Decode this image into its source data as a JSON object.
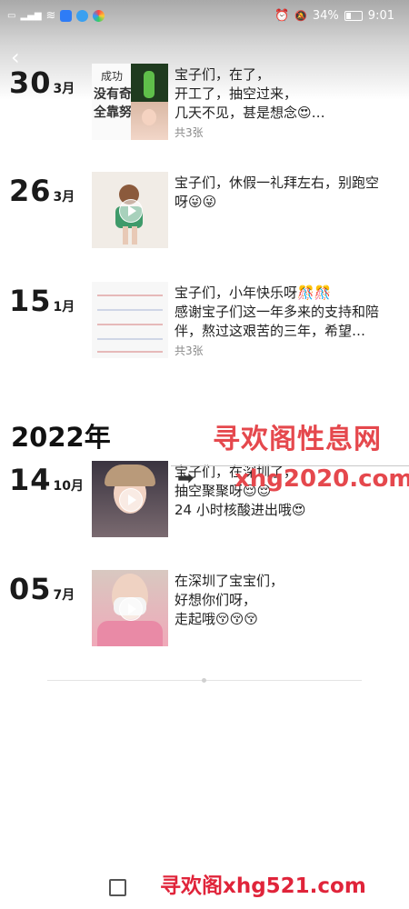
{
  "status_bar": {
    "battery": "34%",
    "time": "9:01",
    "left_icons": [
      "sim-icon",
      "signal-icon",
      "wifi-icon",
      "app-icon-blue",
      "app-icon-globe",
      "app-icon-color"
    ]
  },
  "nav": {
    "back_icon": "chevron-left-icon"
  },
  "entries": [
    {
      "day": "30",
      "month": "3月",
      "lines": [
        "宝子们，在了，",
        "开工了，抽空过来，",
        "几天不见，甚是想念😍…"
      ],
      "count": "共3张",
      "thumb_text": [
        "成功",
        "没有奇",
        "全靠努"
      ],
      "has_video": false
    },
    {
      "day": "26",
      "month": "3月",
      "lines": [
        "宝子们，休假一礼拜左右，别跑空",
        "呀😜😜"
      ],
      "count": "",
      "has_video": true
    },
    {
      "day": "15",
      "month": "1月",
      "lines": [
        "宝子们，小年快乐呀🎊🎊",
        "感谢宝子们这一年多来的支持和陪",
        "伴，熬过这艰苦的三年，希望…"
      ],
      "count": "共3张",
      "has_video": false
    },
    {
      "day": "14",
      "month": "10月",
      "lines": [
        "宝子们，在深圳了，",
        "抽空聚聚呀😌😌",
        "24 小时核酸进出哦😍"
      ],
      "count": "",
      "has_video": true
    },
    {
      "day": "05",
      "month": "7月",
      "lines": [
        "在深圳了宝宝们，",
        "好想你们呀，",
        "走起哦😚😚😚"
      ],
      "count": "",
      "has_video": true
    }
  ],
  "year_header": "2022年",
  "watermarks": {
    "top": "寻欢阁性息网",
    "url": "xhg2020.com",
    "bottom": "寻欢阁xhg521.com"
  },
  "colors": {
    "watermark": "#e5484d",
    "accent_gradient_top": "#a9a9a9"
  }
}
